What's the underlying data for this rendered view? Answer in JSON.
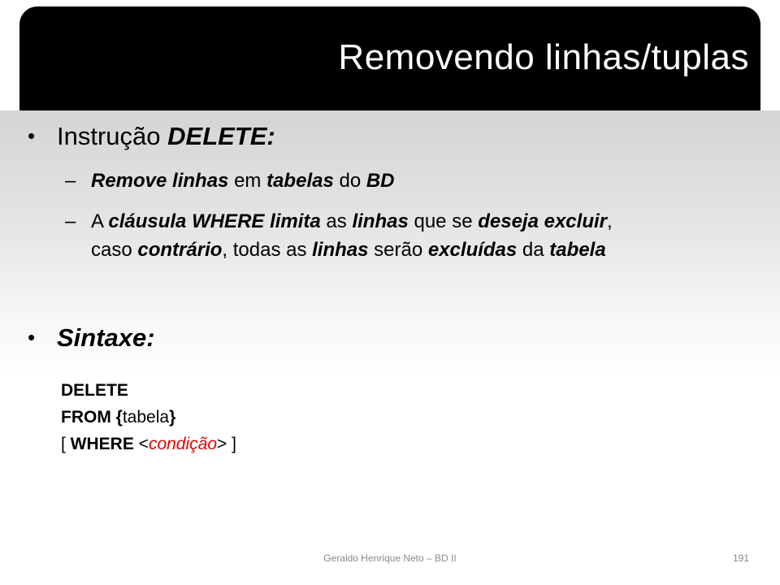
{
  "slide": {
    "title": "Removendo linhas/tuplas",
    "bullet1": {
      "text": "Instrução ",
      "emph": "DELETE:"
    },
    "sub1": {
      "dash": "–",
      "p1": "Remove linhas",
      "p2": " em ",
      "p3": "tabelas",
      "p4": " do ",
      "p5": "BD"
    },
    "sub2": {
      "dash": "–",
      "p1": "A ",
      "p2": "cláusula WHERE limita",
      "p3": " as ",
      "p4": "linhas",
      "p5": " que se ",
      "p6": "deseja excluir",
      "p7": ",",
      "p8": "caso ",
      "p9": "contrário",
      "p10": ", todas as ",
      "p11": "linhas",
      "p12": " serão ",
      "p13": "excluídas",
      "p14": " da ",
      "p15": "tabela"
    },
    "bullet2": {
      "emph": "Sintaxe:"
    },
    "code": {
      "line1": "DELETE",
      "line2_kw": "FROM",
      "line2_brace_open": " {",
      "line2_text": "tabela",
      "line2_brace_close": "}",
      "line3_open": "[ ",
      "line3_kw": "WHERE",
      "line3_lt": " <",
      "line3_cond": "condição",
      "line3_gt": "> ]"
    },
    "footer": "Geraldo Henrique Neto – BD II",
    "page_number": "191",
    "colors": {
      "title_bar": "#000000",
      "title_text": "#ffffff",
      "highlight": "#e00000"
    }
  }
}
